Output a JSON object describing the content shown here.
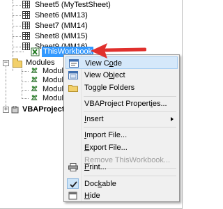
{
  "tree": {
    "sheets": [
      {
        "label": "Sheet5 (MyTestSheet)"
      },
      {
        "label": "Sheet6 (MM13)"
      },
      {
        "label": "Sheet7 (MM14)"
      },
      {
        "label": "Sheet8 (MM15)"
      },
      {
        "label": "Sheet9 (MM16)"
      }
    ],
    "this_workbook": "ThisWorkbook",
    "modules_folder": "Modules",
    "modules": [
      {
        "label": "Module"
      },
      {
        "label": "Module"
      },
      {
        "label": "Module"
      },
      {
        "label": "Module"
      }
    ],
    "project": "VBAProject ("
  },
  "context_menu": {
    "items": {
      "view_code": {
        "before": "View C",
        "mnemonic": "o",
        "after": "de"
      },
      "view_object": {
        "before": "View O",
        "mnemonic": "b",
        "after": "ject"
      },
      "toggle_folders": {
        "before": "Toggle Folders",
        "mnemonic": "",
        "after": ""
      },
      "vbaproject_properties": {
        "before": "VBAProject Propert",
        "mnemonic": "i",
        "after": "es..."
      },
      "insert": {
        "before": "",
        "mnemonic": "I",
        "after": "nsert"
      },
      "import_file": {
        "before": "",
        "mnemonic": "I",
        "after": "mport File..."
      },
      "export_file": {
        "before": "",
        "mnemonic": "E",
        "after": "xport File..."
      },
      "remove": {
        "before": "",
        "mnemonic": "R",
        "after": "emove ThisWorkbook..."
      },
      "print": {
        "before": "",
        "mnemonic": "P",
        "after": "rint..."
      },
      "dockable": {
        "before": "Doc",
        "mnemonic": "k",
        "after": "able"
      },
      "hide": {
        "before": "",
        "mnemonic": "H",
        "after": "ide"
      }
    },
    "dockable_checked": true,
    "highlighted_item": "View Code"
  },
  "annotation": {
    "arrow_color": "#e0302d"
  },
  "colors": {
    "selection": "#3399ff",
    "menu_bg": "#f0f0f0",
    "menu_highlight": "#d5e8fa"
  }
}
